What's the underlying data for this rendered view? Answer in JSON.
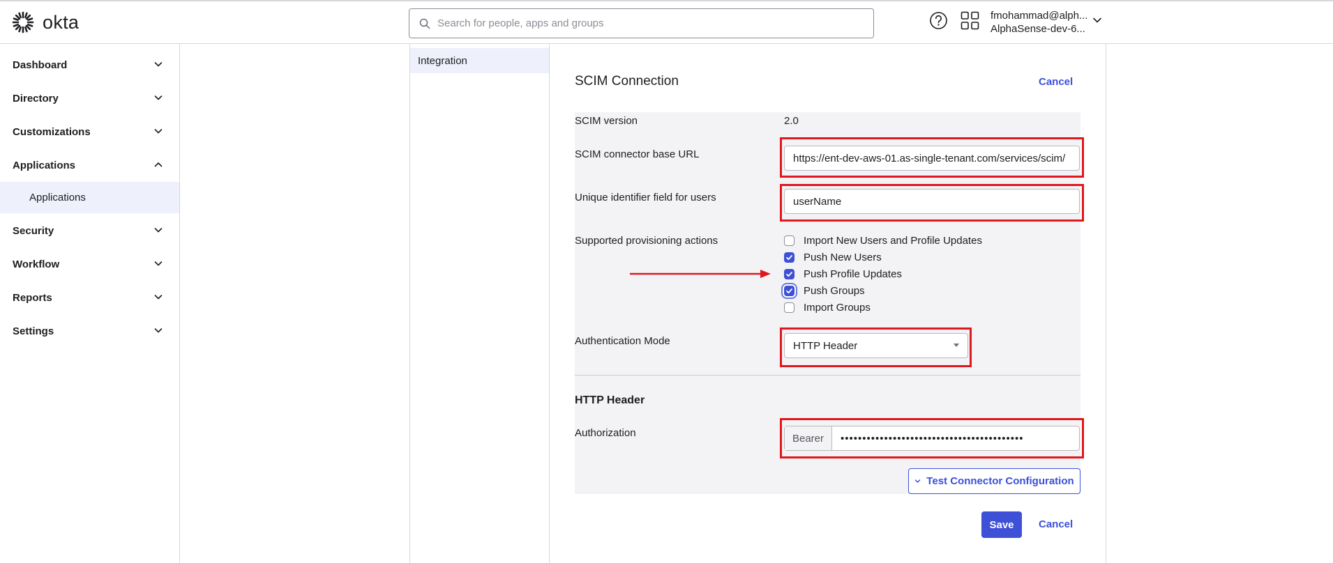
{
  "header": {
    "logo_text": "okta",
    "search_placeholder": "Search for people, apps and groups",
    "user_email": "fmohammad@alph...",
    "user_org": "AlphaSense-dev-6..."
  },
  "sidebar": {
    "items": [
      {
        "label": "Dashboard"
      },
      {
        "label": "Directory"
      },
      {
        "label": "Customizations"
      },
      {
        "label": "Applications"
      },
      {
        "label": "Security"
      },
      {
        "label": "Workflow"
      },
      {
        "label": "Reports"
      },
      {
        "label": "Settings"
      }
    ],
    "sub_item": "Applications"
  },
  "tabs": {
    "integration": "Integration"
  },
  "form": {
    "title": "SCIM Connection",
    "cancel_top": "Cancel",
    "scim_version_label": "SCIM version",
    "scim_version_value": "2.0",
    "base_url_label": "SCIM connector base URL",
    "base_url_value": "https://ent-dev-aws-01.as-single-tenant.com/services/scim/",
    "unique_id_label": "Unique identifier field for users",
    "unique_id_value": "userName",
    "provisioning_label": "Supported provisioning actions",
    "actions": [
      {
        "label": "Import New Users and Profile Updates",
        "checked": false
      },
      {
        "label": "Push New Users",
        "checked": true
      },
      {
        "label": "Push Profile Updates",
        "checked": true
      },
      {
        "label": "Push Groups",
        "checked": true
      },
      {
        "label": "Import Groups",
        "checked": false
      }
    ],
    "auth_mode_label": "Authentication Mode",
    "auth_mode_value": "HTTP Header",
    "http_header_title": "HTTP Header",
    "authorization_label": "Authorization",
    "bearer_prefix": "Bearer",
    "authorization_value": "••••••••••••••••••••••••••••••••••••••••••",
    "test_button": "Test Connector Configuration",
    "save_button": "Save",
    "cancel_bottom": "Cancel"
  },
  "colors": {
    "accent": "#3d50d6",
    "link": "#3a50d9",
    "highlight_box": "#e0171c",
    "panel": "#f3f3f6"
  }
}
